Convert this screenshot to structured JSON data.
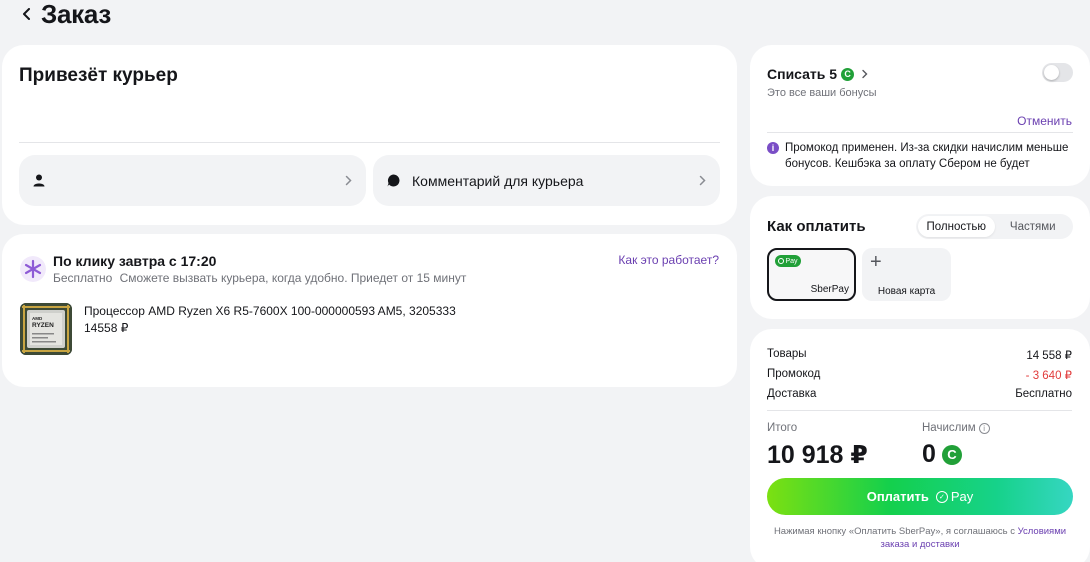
{
  "header": {
    "title": "Заказ"
  },
  "delivery": {
    "title": "Привезёт курьер",
    "recipient_label": "",
    "comment_label": "Комментарий для курьера"
  },
  "shipment": {
    "title": "По клику завтра с 17:20",
    "price_label": "Бесплатно",
    "description": "Сможете вызвать курьера, когда удобно. Приедет от 15 минут",
    "how_link": "Как это работает?",
    "product_name": "Процессор AMD Ryzen X6 R5-7600X 100-000000593 AM5, 3205333",
    "product_price": "14558 ₽",
    "product_brand": "AMD",
    "product_model": "RYZEN"
  },
  "bonus": {
    "title": "Списать 5",
    "subtitle": "Это все ваши бонусы",
    "cancel_link": "Отменить",
    "promo_message": "Промокод применен. Из-за скидки начислим меньше бонусов. Кешбэка за оплату Сбером не будет",
    "toggle_on": false
  },
  "payment": {
    "title": "Как оплатить",
    "tabs": [
      "Полностью",
      "Частями"
    ],
    "active_tab": "Полностью",
    "methods": [
      {
        "label": "SberPay",
        "badge": "Pay",
        "selected": true
      },
      {
        "label": "Новая карта",
        "selected": false
      }
    ]
  },
  "summary": {
    "rows": [
      {
        "label": "Товары",
        "value": "14 558 ₽"
      },
      {
        "label": "Промокод",
        "value": "- 3 640 ₽"
      },
      {
        "label": "Доставка",
        "value": "Бесплатно"
      }
    ],
    "total_label": "Итого",
    "total_value": "10 918 ₽",
    "bonus_label": "Начислим",
    "bonus_value": "0",
    "pay_button": "Оплатить",
    "pay_button_suffix": "Pay",
    "legal_text": "Нажимая кнопку «Оплатить SberPay», я соглашаюсь с ",
    "legal_link": "Условиями заказа и доставки"
  },
  "colors": {
    "accent_purple": "#6a3fb0",
    "sber_green": "#21a038",
    "discount_red": "#e13b3b"
  }
}
